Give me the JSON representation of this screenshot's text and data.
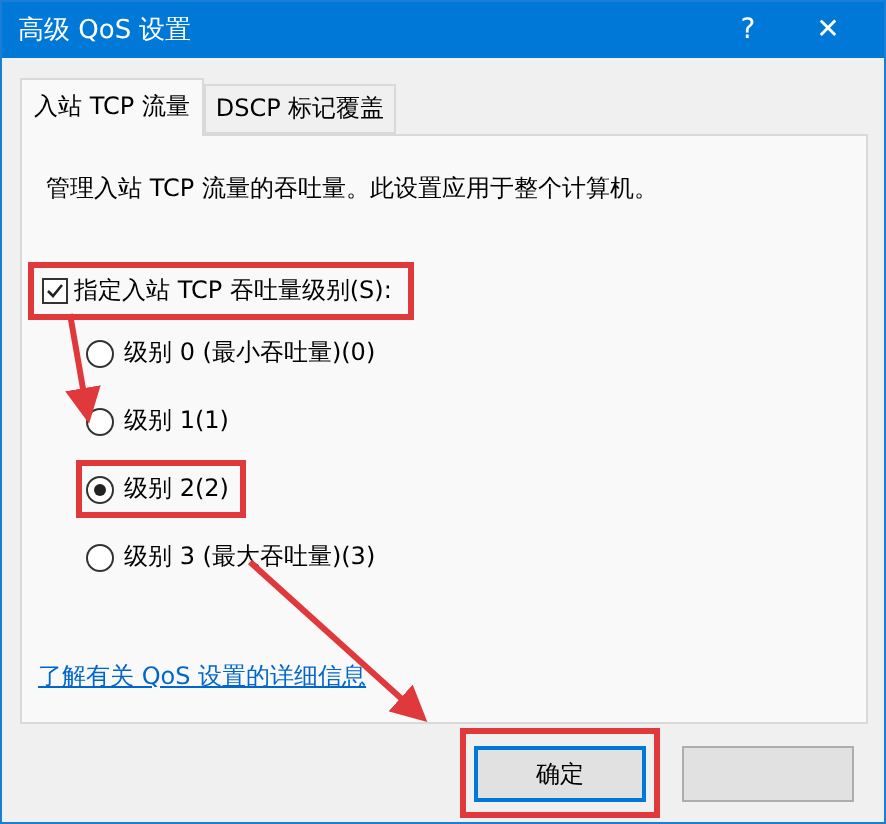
{
  "window": {
    "title": "高级 QoS 设置",
    "help": "?",
    "close": "✕"
  },
  "tabs": [
    {
      "label": "入站 TCP 流量",
      "selected": true
    },
    {
      "label": "DSCP 标记覆盖",
      "selected": false
    }
  ],
  "description": "管理入站 TCP 流量的吞吐量。此设置应用于整个计算机。",
  "checkbox": {
    "label": "指定入站 TCP 吞吐量级别(S):",
    "checked": true,
    "highlighted": true
  },
  "levels": [
    {
      "label": "级别 0 (最小吞吐量)(0)",
      "selected": false,
      "highlighted": false
    },
    {
      "label": "级别 1(1)",
      "selected": false,
      "highlighted": false
    },
    {
      "label": "级别 2(2)",
      "selected": true,
      "highlighted": true
    },
    {
      "label": "级别 3 (最大吞吐量)(3)",
      "selected": false,
      "highlighted": false
    }
  ],
  "link": "了解有关 QoS 设置的详细信息",
  "buttons": [
    {
      "label": "确定",
      "default": true,
      "highlighted": true
    },
    {
      "default": false,
      "highlighted": false
    }
  ]
}
